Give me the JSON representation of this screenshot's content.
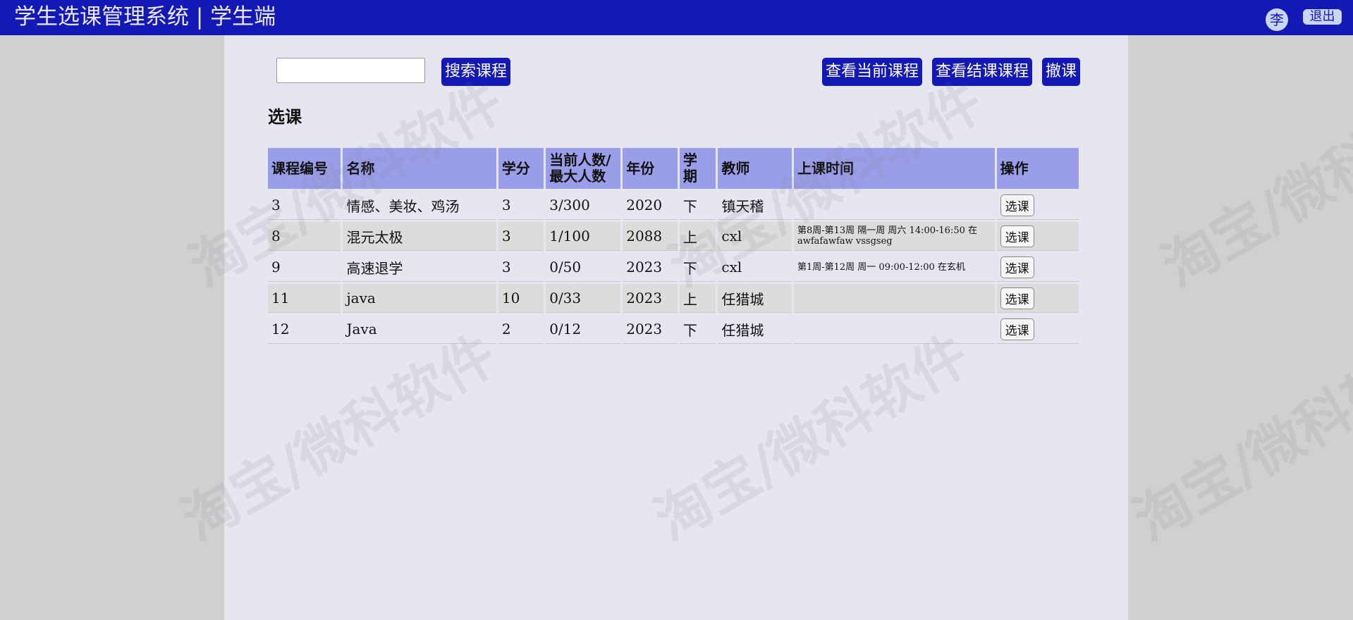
{
  "header": {
    "title": "学生选课管理系统 | 学生端",
    "avatar_text": "李",
    "logout_label": "退出"
  },
  "toolbar": {
    "search_placeholder": "",
    "search_button": "搜索课程",
    "current_courses_button": "查看当前课程",
    "finished_courses_button": "查看结课课程",
    "drop_button": "撤课"
  },
  "section_title": "选课",
  "table": {
    "columns": [
      "课程编号",
      "名称",
      "学分",
      "当前人数/最大人数",
      "年份",
      "学期",
      "教师",
      "上课时间",
      "操作"
    ],
    "rows": [
      {
        "id": "3",
        "name": "情感、美妆、鸡汤",
        "credit": "3",
        "count": "3/300",
        "year": "2020",
        "term": "下",
        "teacher": "镇天稽",
        "time": "",
        "action": "选课"
      },
      {
        "id": "8",
        "name": "混元太极",
        "credit": "3",
        "count": "1/100",
        "year": "2088",
        "term": "上",
        "teacher": "cxl",
        "time": "第8周-第13周 隔一周 周六 14:00-16:50 在 awfafawfaw vssgseg",
        "action": "选课"
      },
      {
        "id": "9",
        "name": "高速退学",
        "credit": "3",
        "count": "0/50",
        "year": "2023",
        "term": "下",
        "teacher": "cxl",
        "time": "第1周-第12周 周一 09:00-12:00 在玄机",
        "action": "选课"
      },
      {
        "id": "11",
        "name": "java",
        "credit": "10",
        "count": "0/33",
        "year": "2023",
        "term": "上",
        "teacher": "任猎城",
        "time": "",
        "action": "选课"
      },
      {
        "id": "12",
        "name": "Java",
        "credit": "2",
        "count": "0/12",
        "year": "2023",
        "term": "下",
        "teacher": "任猎城",
        "time": "",
        "action": "选课"
      }
    ]
  },
  "watermark_text": "淘宝/微科软件",
  "colors": {
    "topbar": "#1418b4",
    "header_cell": "#9a9ee8",
    "main_bg": "#e6e6f0",
    "side_bg": "#d0d0d0"
  }
}
